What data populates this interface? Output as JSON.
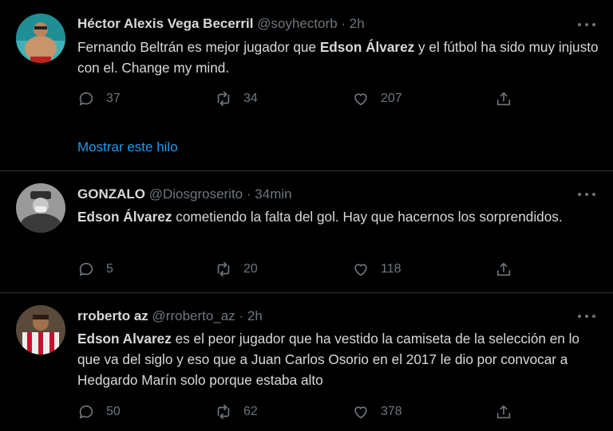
{
  "tweets": [
    {
      "name": "Héctor Alexis Vega Becerril",
      "handle": "@soyhectorb",
      "separator": "·",
      "time": "2h",
      "text_parts": [
        "Fernando Beltrán es mejor jugador que ",
        "Edson Álvarez",
        " y el fútbol ha sido muy injusto con el. Change my mind."
      ],
      "replies": "37",
      "retweets": "34",
      "likes": "207",
      "thread_link": "Mostrar este hilo"
    },
    {
      "name": "GONZALO",
      "handle": "@Diosgroserito",
      "separator": "·",
      "time": "34min",
      "text_parts": [
        "",
        "Edson Álvarez",
        " cometiendo la falta del gol. Hay que hacernos los sorprendidos."
      ],
      "replies": "5",
      "retweets": "20",
      "likes": "118"
    },
    {
      "name": "rroberto az",
      "handle": "@rroberto_az",
      "separator": "·",
      "time": "2h",
      "text_parts": [
        "",
        "Edson Alvarez",
        " es el peor jugador que ha vestido la camiseta de la selección en lo que va del siglo y eso que a Juan Carlos Osorio en el 2017 le dio por convocar a Hedgardo Marín solo porque estaba alto"
      ],
      "replies": "50",
      "retweets": "62",
      "likes": "378"
    }
  ],
  "icons": {
    "reply": "reply-icon",
    "retweet": "retweet-icon",
    "like": "heart-icon",
    "share": "share-icon",
    "more": "more-icon"
  },
  "colors": {
    "background": "#000000",
    "text": "#d9d9d9",
    "muted": "#6e767d",
    "link": "#1d9bf0",
    "divider": "#2f3336"
  }
}
